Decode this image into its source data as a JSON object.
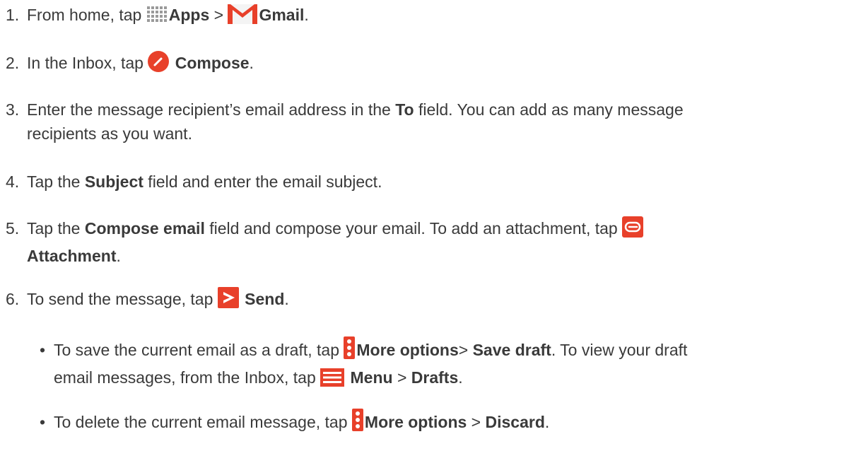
{
  "steps": [
    {
      "num": "1.",
      "pre": "From home, tap ",
      "b1": "Apps",
      "mid": " > ",
      "b2": "Gmail",
      "post": "."
    },
    {
      "num": "2.",
      "pre": "In the Inbox, tap ",
      "b1": "Compose",
      "post": "."
    },
    {
      "num": "3.",
      "pre": "Enter the message recipient’s email address in the ",
      "b1": "To",
      "post": " field. You can add as many message",
      "line2": "recipients as you want."
    },
    {
      "num": "4.",
      "pre": "Tap the ",
      "b1": "Subject",
      "post": " field and enter the email subject."
    },
    {
      "num": "5.",
      "pre": "Tap the ",
      "b1": "Compose email",
      "post": " field and compose your email. To add an attachment, tap ",
      "b2": "Attachment",
      "post2": "."
    },
    {
      "num": "6.",
      "pre": "To send the message, tap ",
      "b1": "Send",
      "post": "."
    }
  ],
  "bullets": [
    {
      "dot": "•",
      "pre": "To save the current email as a draft, tap ",
      "b1": "More options",
      "mid": "> ",
      "b2": "Save draft",
      "post": ". To view your draft",
      "line2pre": "email messages, from the Inbox, tap ",
      "b3": "Menu",
      "mid2": " > ",
      "b4": "Drafts",
      "post2": "."
    },
    {
      "dot": "•",
      "pre": "To delete the current email message, tap ",
      "b1": "More options",
      "mid": " > ",
      "b2": "Discard",
      "post": "."
    }
  ],
  "colors": {
    "accent": "#e8402a",
    "text": "#3a3a3a"
  },
  "icons": [
    "apps-grid-icon",
    "gmail-icon",
    "compose-pencil-icon",
    "attachment-clip-icon",
    "send-arrow-icon",
    "more-options-icon",
    "menu-icon"
  ]
}
